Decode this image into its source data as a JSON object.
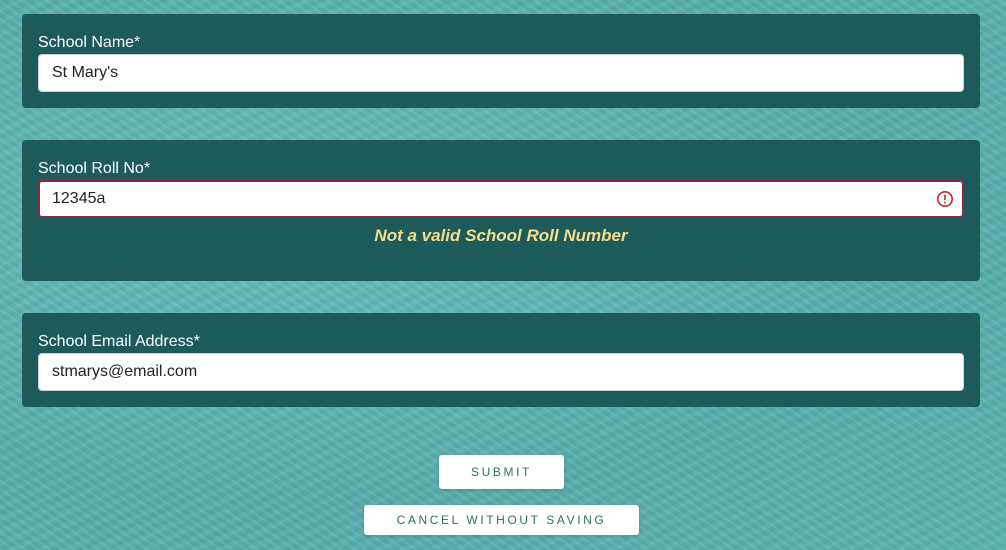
{
  "form": {
    "school_name": {
      "label": "School Name*",
      "value": "St Mary's"
    },
    "school_roll": {
      "label": "School Roll No*",
      "value": "12345a",
      "error_icon": "exclamation-circle-icon",
      "error_message": "Not a valid School Roll Number"
    },
    "school_email": {
      "label": "School Email Address*",
      "value": "stmarys@email.com"
    }
  },
  "actions": {
    "submit_label": "SUBMIT",
    "cancel_label": "CANCEL WITHOUT SAVING"
  },
  "colors": {
    "background": "#5bb3b2",
    "panel": "#1d5a5a",
    "error_border": "#8a2a3c",
    "error_icon": "#c0283c",
    "error_text": "#f3dd8e",
    "button_text": "#2f6f5e"
  }
}
